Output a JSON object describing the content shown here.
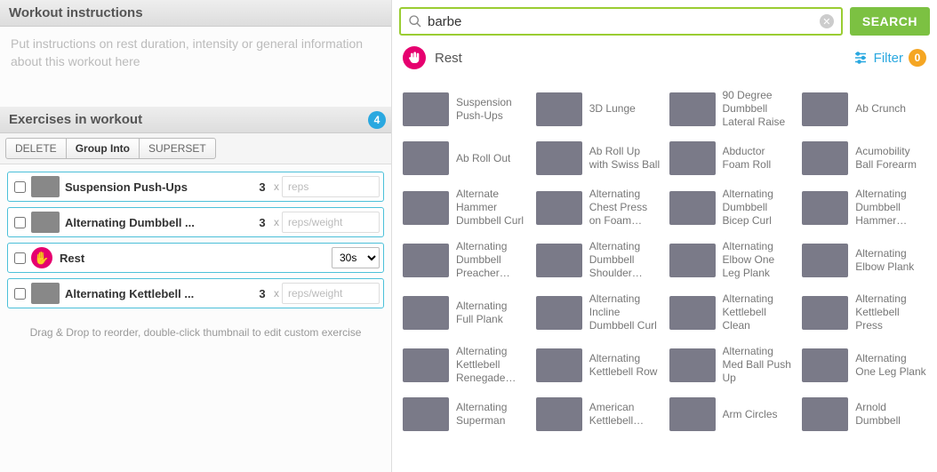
{
  "instructions": {
    "header": "Workout instructions",
    "placeholder": "Put instructions on rest duration, intensity or general information about this workout here"
  },
  "workout": {
    "header": "Exercises in workout",
    "count": "4",
    "toolbar": {
      "delete": "DELETE",
      "group": "Group Into",
      "superset": "SUPERSET"
    },
    "rows": [
      {
        "type": "ex",
        "name": "Suspension Push-Ups",
        "sets": "3",
        "x": "x",
        "reps_ph": "reps"
      },
      {
        "type": "ex",
        "name": "Alternating Dumbbell ...",
        "sets": "3",
        "x": "x",
        "reps_ph": "reps/weight"
      },
      {
        "type": "rest",
        "name": "Rest",
        "duration": "30s"
      },
      {
        "type": "ex",
        "name": "Alternating Kettlebell ...",
        "sets": "3",
        "x": "x",
        "reps_ph": "reps/weight"
      }
    ],
    "hint": "Drag & Drop to reorder, double-click thumbnail to edit custom exercise"
  },
  "search": {
    "value": "barbe",
    "button": "SEARCH"
  },
  "rest_quick": {
    "label": "Rest"
  },
  "filter": {
    "label": "Filter",
    "count": "0"
  },
  "library": [
    "Suspension Push-Ups",
    "3D Lunge",
    "90 Degree Dumbbell Lateral Raise",
    "Ab Crunch",
    "Ab Roll Out",
    "Ab Roll Up with Swiss Ball",
    "Abductor Foam Roll",
    "Acumobility Ball Forearm",
    "Alternate Hammer Dumbbell Curl",
    "Alternating Chest Press on Foam…",
    "Alternating Dumbbell Bicep Curl",
    "Alternating Dumbbell Hammer…",
    "Alternating Dumbbell Preacher…",
    "Alternating Dumbbell Shoulder…",
    "Alternating Elbow One Leg Plank",
    "Alternating Elbow Plank",
    "Alternating Full Plank",
    "Alternating Incline Dumbbell Curl",
    "Alternating Kettlebell Clean",
    "Alternating Kettlebell Press",
    "Alternating Kettlebell Renegade…",
    "Alternating Kettlebell Row",
    "Alternating Med Ball Push Up",
    "Alternating One Leg Plank",
    "Alternating Superman",
    "American Kettlebell…",
    "Arm Circles",
    "Arnold Dumbbell"
  ]
}
